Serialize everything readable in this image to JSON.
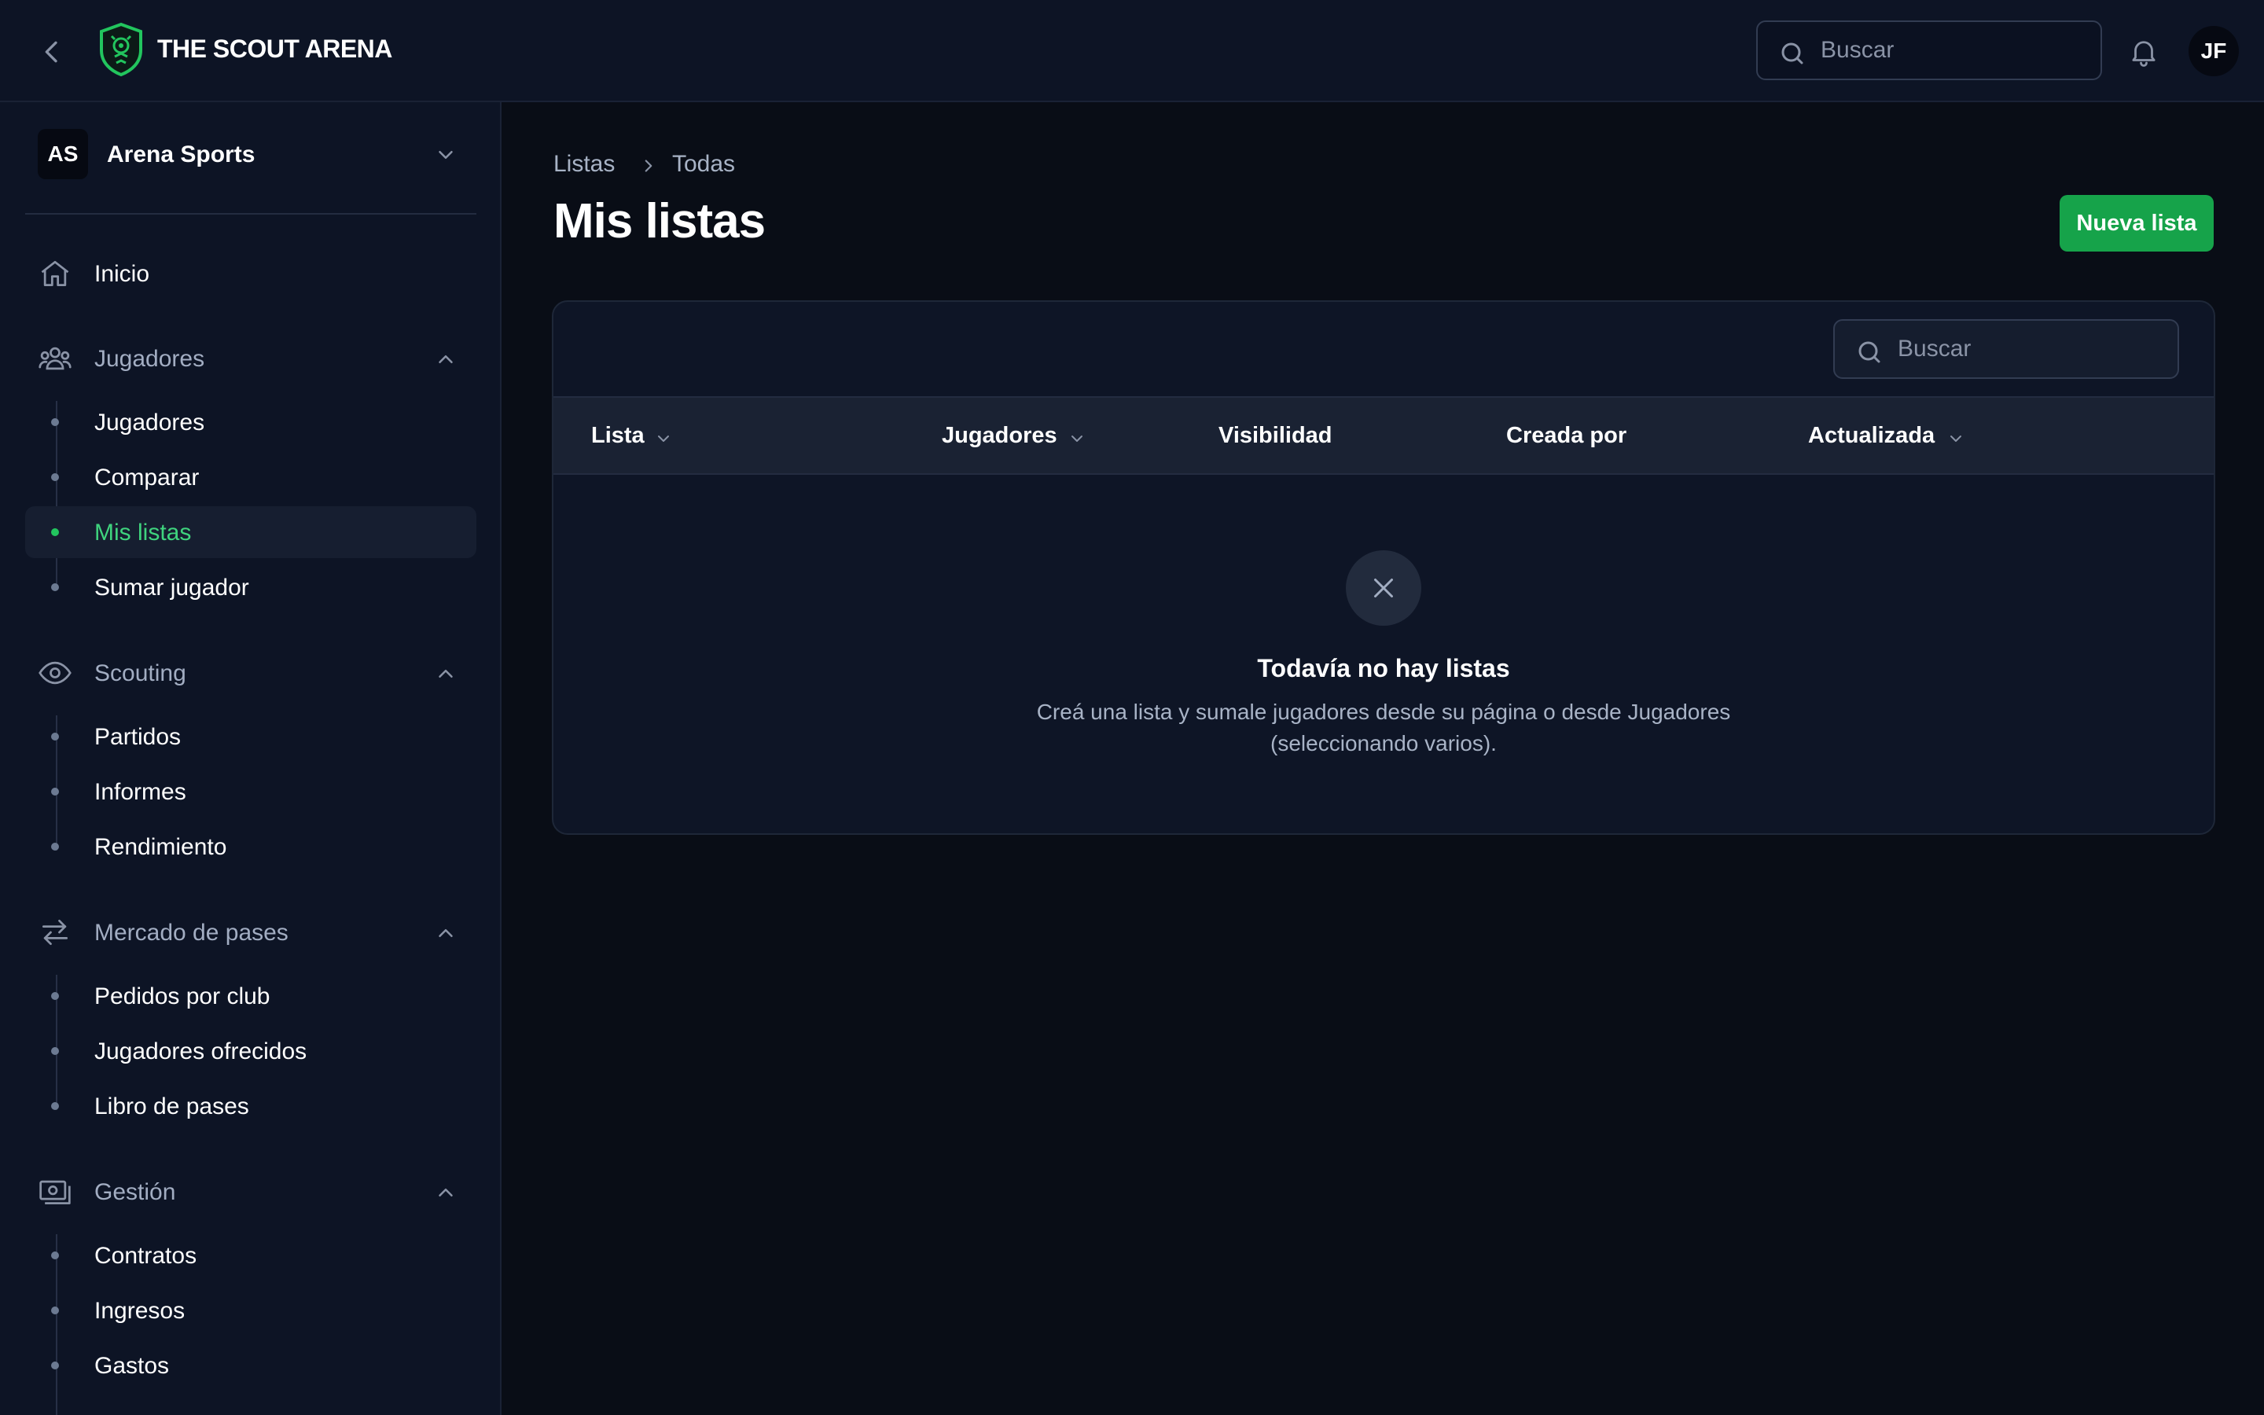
{
  "header": {
    "brand": "THE SCOUT ARENA",
    "search_placeholder": "Buscar",
    "avatar_initials": "JF"
  },
  "sidebar": {
    "org": {
      "initials": "AS",
      "name": "Arena Sports"
    },
    "home": {
      "label": "Inicio",
      "icon": "home-icon"
    },
    "groups": [
      {
        "label": "Jugadores",
        "icon": "users-icon",
        "expanded": true,
        "items": [
          "Jugadores",
          "Comparar",
          "Mis listas",
          "Sumar jugador"
        ]
      },
      {
        "label": "Scouting",
        "icon": "eye-icon",
        "expanded": true,
        "items": [
          "Partidos",
          "Informes",
          "Rendimiento"
        ]
      },
      {
        "label": "Mercado de pases",
        "icon": "transfer-arrows-icon",
        "expanded": true,
        "items": [
          "Pedidos por club",
          "Jugadores ofrecidos",
          "Libro de pases"
        ]
      },
      {
        "label": "Gestión",
        "icon": "money-icon",
        "expanded": true,
        "items": [
          "Contratos",
          "Ingresos",
          "Gastos"
        ]
      }
    ],
    "active_item": "Mis listas"
  },
  "main": {
    "breadcrumb": [
      "Listas",
      "Todas"
    ],
    "title": "Mis listas",
    "new_button": "Nueva lista",
    "table": {
      "search_placeholder": "Buscar",
      "columns": [
        {
          "label": "Lista",
          "sortable": true
        },
        {
          "label": "Jugadores",
          "sortable": true
        },
        {
          "label": "Visibilidad",
          "sortable": false
        },
        {
          "label": "Creada por",
          "sortable": false
        },
        {
          "label": "Actualizada",
          "sortable": true
        }
      ],
      "rows": []
    },
    "empty_state": {
      "icon": "close-x-icon",
      "title": "Todavía no hay listas",
      "description": "Creá una lista y sumale jugadores desde su página o desde Jugadores (seleccionando varios)."
    }
  },
  "colors": {
    "background": "#090d16",
    "surface": "#0d1425",
    "accent": "#16a34a",
    "active_text": "#3fd47e"
  }
}
